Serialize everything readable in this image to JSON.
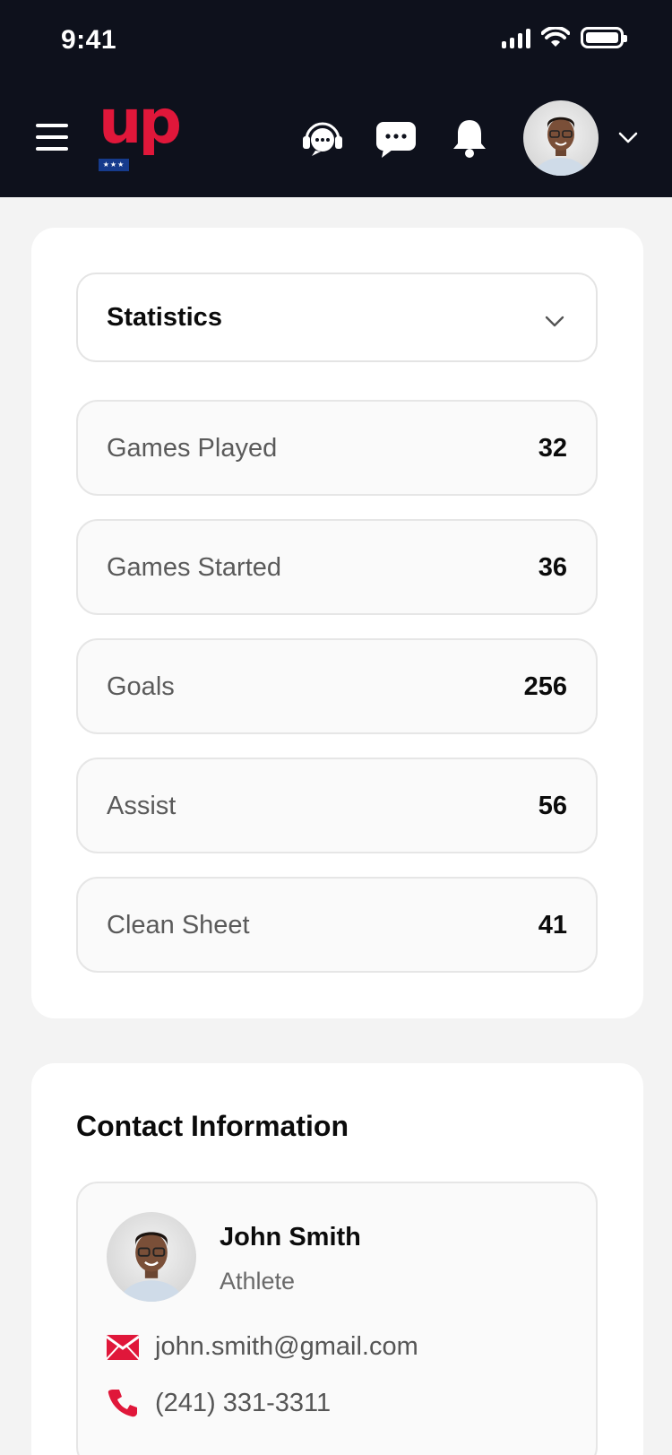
{
  "status_bar": {
    "time": "9:41"
  },
  "header": {
    "logo_text": "UP",
    "logo_stars": "★★★",
    "icons": [
      "menu-icon",
      "support-chat-icon",
      "messages-icon",
      "bell-icon",
      "avatar",
      "chevron-down-icon"
    ]
  },
  "statistics": {
    "dropdown_label": "Statistics",
    "rows": [
      {
        "name": "Games Played",
        "value": "32"
      },
      {
        "name": "Games Started",
        "value": "36"
      },
      {
        "name": "Goals",
        "value": "256"
      },
      {
        "name": "Assist",
        "value": "56"
      },
      {
        "name": "Clean Sheet",
        "value": "41"
      }
    ]
  },
  "contact": {
    "title": "Contact Information",
    "name": "John Smith",
    "role": "Athlete",
    "email": "john.smith@gmail.com",
    "phone": "(241) 331-3311"
  },
  "colors": {
    "header_bg": "#0e111c",
    "brand_red": "#e0173a",
    "brand_blue": "#163b8c",
    "page_bg": "#f3f3f3"
  }
}
